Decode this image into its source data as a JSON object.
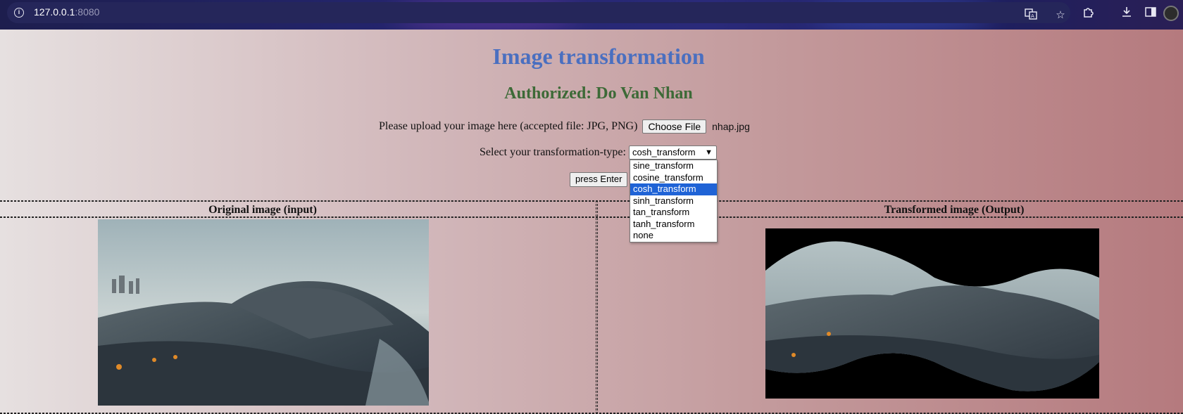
{
  "browser": {
    "url_host": "127.0.0.1",
    "url_port": ":8080",
    "icons": [
      "info-icon",
      "translate-icon",
      "star-icon",
      "extensions-icon",
      "download-icon",
      "sidebar-icon",
      "profile-avatar"
    ]
  },
  "page": {
    "title": "Image transformation",
    "author": "Authorized: Do Van Nhan",
    "upload_label": "Please upload your image here (accepted file: JPG, PNG)",
    "file_button": "Choose File",
    "file_name": "nhap.jpg",
    "select_label": "Select your transformation-type:",
    "select_value": "cosh_transform",
    "options": [
      "sine_transform",
      "cosine_transform",
      "cosh_transform",
      "sinh_transform",
      "tan_transform",
      "tanh_transform",
      "none"
    ],
    "selected_index": 2,
    "enter_button": "press Enter",
    "col_input": "Original image (input)",
    "col_output": "Transformed image (Output)"
  },
  "colors": {
    "title": "#4a6fc0",
    "author": "#3d6a37",
    "highlight": "#1f63d6"
  }
}
